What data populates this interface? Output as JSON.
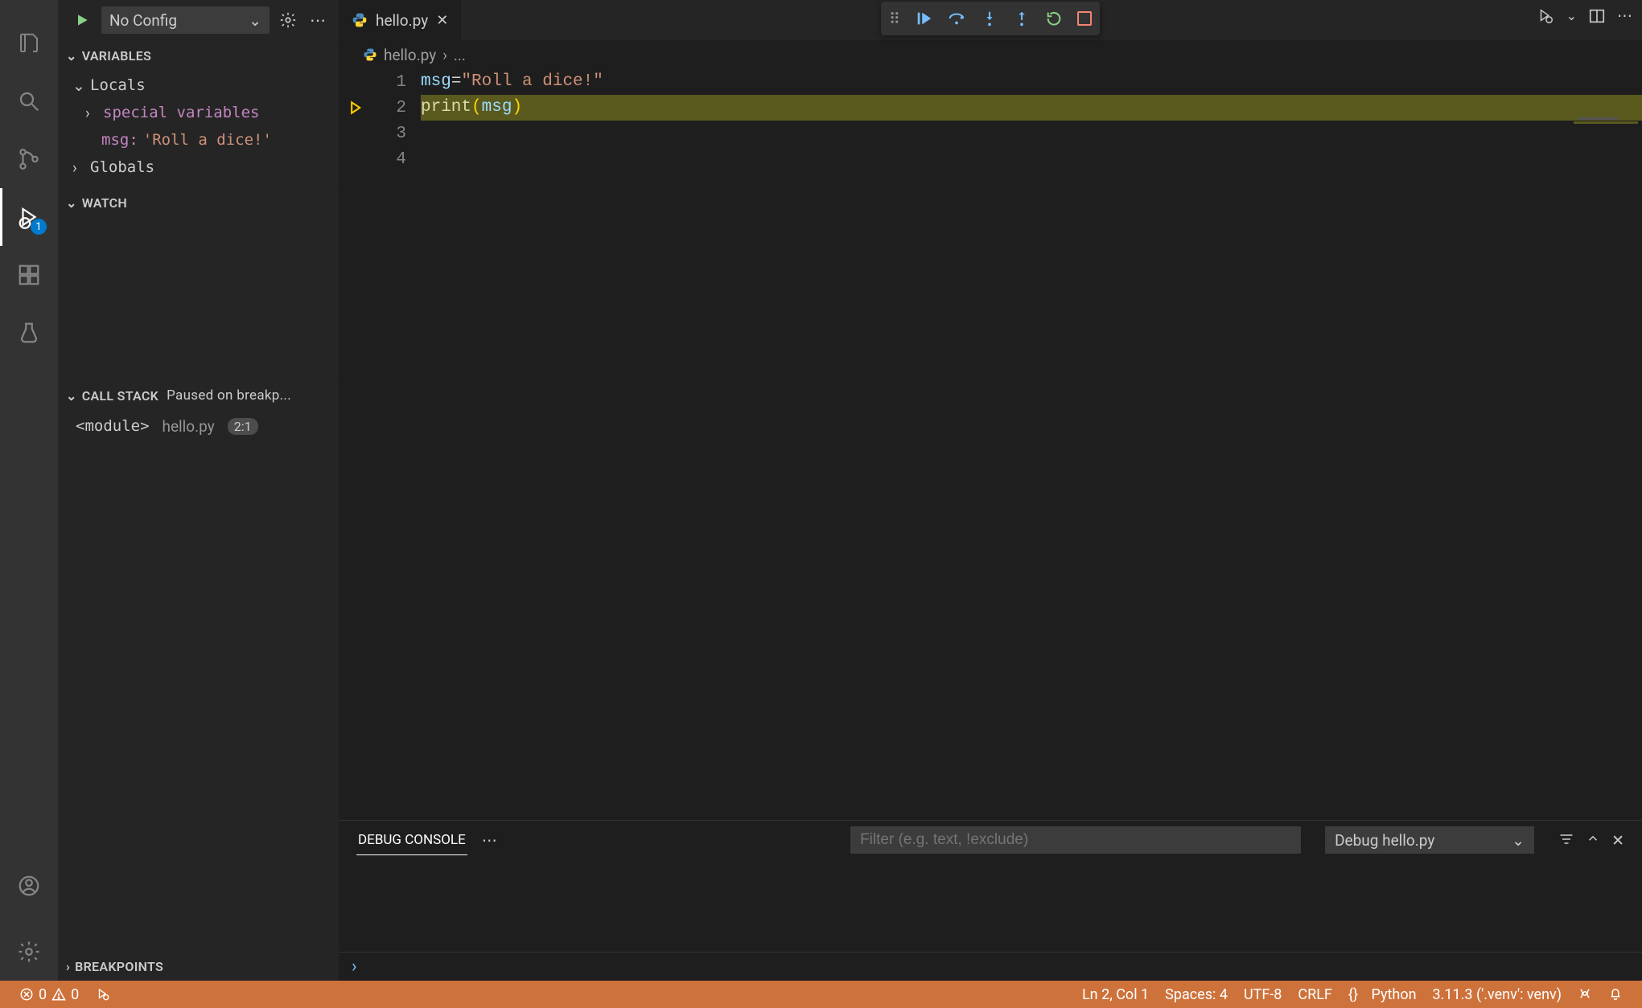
{
  "activity": {
    "debug_badge": "1"
  },
  "sidebar": {
    "config_label": "No Config",
    "variables": {
      "title": "VARIABLES",
      "locals_label": "Locals",
      "special_label": "special variables",
      "msg_name": "msg:",
      "msg_value": "'Roll a dice!'",
      "globals_label": "Globals"
    },
    "watch": {
      "title": "WATCH"
    },
    "callstack": {
      "title": "CALL STACK",
      "status": "Paused on breakp...",
      "frame_name": "<module>",
      "frame_file": "hello.py",
      "frame_pos": "2:1"
    },
    "breakpoints": {
      "title": "BREAKPOINTS"
    }
  },
  "tabs": {
    "file": "hello.py"
  },
  "breadcrumb": {
    "file": "hello.py",
    "more": "..."
  },
  "code": {
    "lines": [
      "1",
      "2",
      "3",
      "4"
    ],
    "l1": {
      "var": "msg",
      "op": " = ",
      "str": "\"Roll a dice!\""
    },
    "l2": {
      "fn": "print",
      "lp": "(",
      "arg": "msg",
      "rp": ")"
    }
  },
  "console": {
    "tab": "DEBUG CONSOLE",
    "filter_placeholder": "Filter (e.g. text, !exclude)",
    "session": "Debug hello.py"
  },
  "status": {
    "errors": "0",
    "warnings": "0",
    "ln_col": "Ln 2, Col 1",
    "spaces": "Spaces: 4",
    "encoding": "UTF-8",
    "eol": "CRLF",
    "lang_brace": "{}",
    "lang": "Python",
    "interpreter": "3.11.3 ('.venv': venv)"
  }
}
